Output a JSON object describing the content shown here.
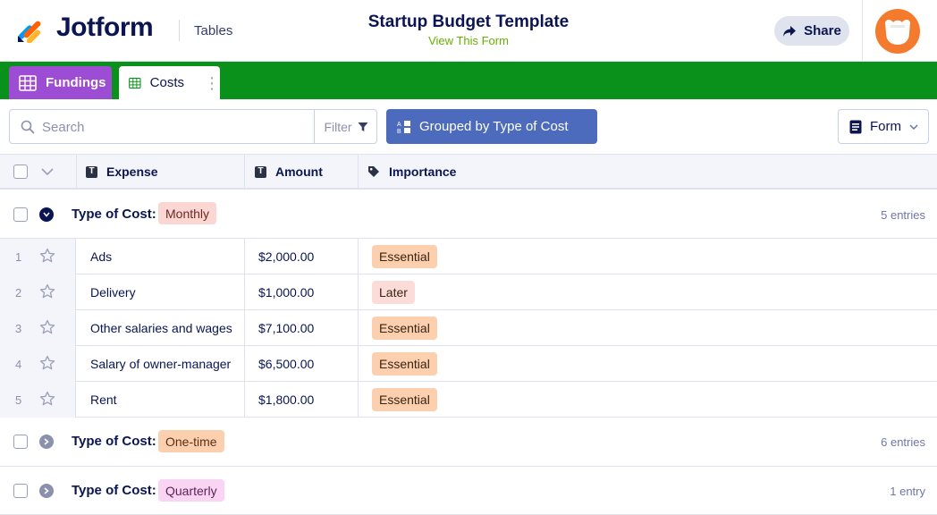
{
  "header": {
    "brand": "Jotform",
    "product": "Tables",
    "title": "Startup Budget Template",
    "subtitle": "View This Form",
    "share_label": "Share"
  },
  "tabs": [
    {
      "label": "Fundings",
      "active": false
    },
    {
      "label": "Costs",
      "active": true
    }
  ],
  "toolbar": {
    "search_placeholder": "Search",
    "filter_label": "Filter",
    "grouped_label": "Grouped by Type of Cost",
    "form_label": "Form"
  },
  "columns": [
    "Expense",
    "Amount",
    "Importance"
  ],
  "groups": [
    {
      "label": "Type of Cost:",
      "value": "Monthly",
      "count": "5 entries",
      "expanded": true
    },
    {
      "label": "Type of Cost:",
      "value": "One-time",
      "count": "6 entries",
      "expanded": false
    },
    {
      "label": "Type of Cost:",
      "value": "Quarterly",
      "count": "1 entry",
      "expanded": false
    }
  ],
  "rows": [
    {
      "num": "1",
      "expense": "Ads",
      "amount": "$2,000.00",
      "importance": "Essential"
    },
    {
      "num": "2",
      "expense": "Delivery",
      "amount": "$1,000.00",
      "importance": "Later"
    },
    {
      "num": "3",
      "expense": "Other salaries and wages",
      "amount": "$7,100.00",
      "importance": "Essential"
    },
    {
      "num": "4",
      "expense": "Salary of owner-manager",
      "amount": "$6,500.00",
      "importance": "Essential"
    },
    {
      "num": "5",
      "expense": "Rent",
      "amount": "$1,800.00",
      "importance": "Essential"
    }
  ],
  "colors": {
    "tab_bar": "#0a911c",
    "fundings_tab": "#9c4dd3",
    "grouped_button": "#4c6bbd",
    "subtitle": "#64b200",
    "badge_monthly": "#fcd6d2",
    "badge_one_time": "#fcd0ae",
    "badge_quarterly": "#f9d4f3",
    "pill_essential": "#fcd0ae",
    "pill_later": "#fcdcd8"
  }
}
